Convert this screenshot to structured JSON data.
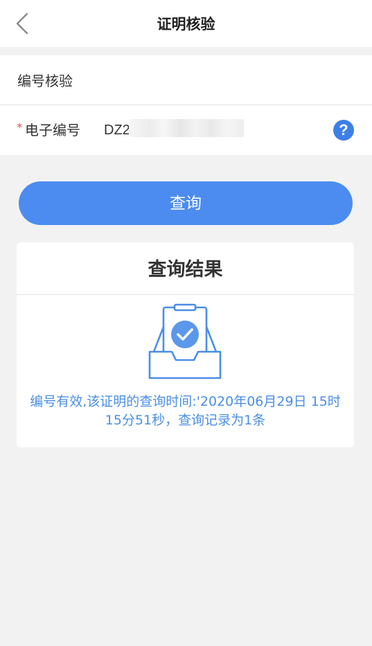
{
  "header": {
    "title": "证明核验",
    "back_icon": "chevron-left-icon"
  },
  "form": {
    "section_title": "编号核验",
    "required_mark": "*",
    "field_label": "电子编号",
    "field_value": "DZ2",
    "help_icon": "?"
  },
  "actions": {
    "query_label": "查询"
  },
  "result": {
    "title": "查询结果",
    "illustration_icon": "checked-document-tray-icon",
    "message": "编号有效,该证明的查询时间:'2020年06月29日 15时15分51秒，查询记录为1条"
  },
  "colors": {
    "accent": "#4c8cf0",
    "result_text": "#4a8ee6",
    "required": "#e9504f",
    "background": "#f2f2f2"
  }
}
